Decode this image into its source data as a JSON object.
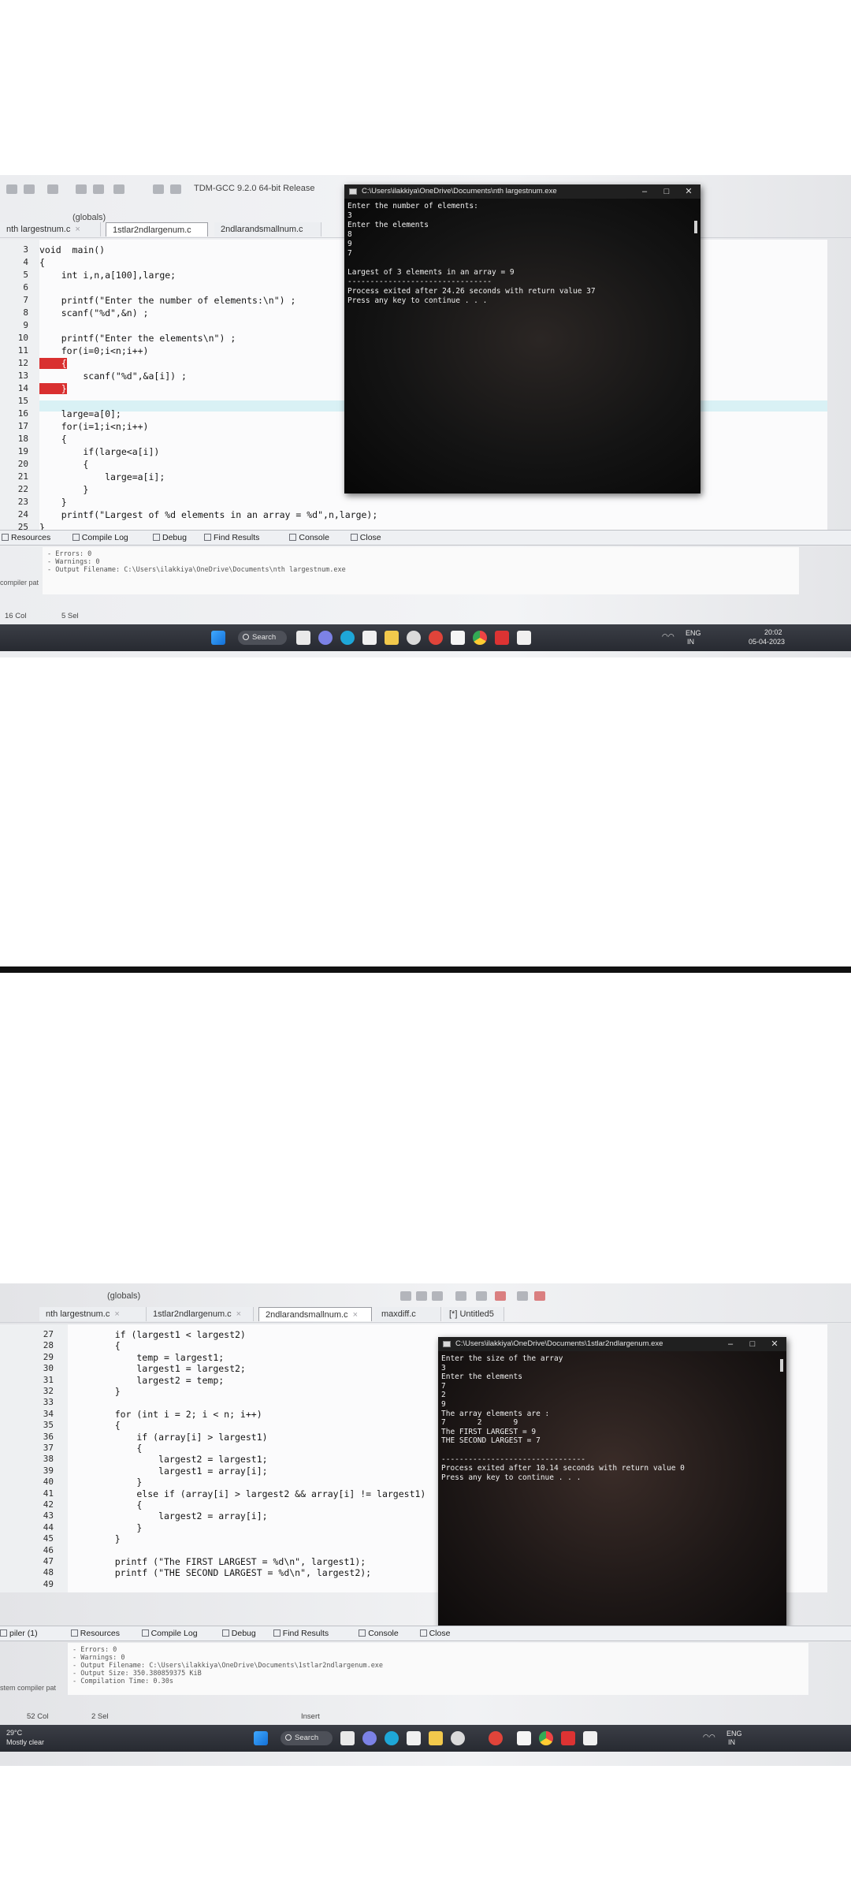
{
  "screen1": {
    "toolbar": {
      "compiler": "TDM-GCC 9.2.0 64-bit Release",
      "scope": "(globals)"
    },
    "tabs": [
      {
        "label": "nth largestnum.c"
      },
      {
        "label": "1stlar2ndlargenum.c"
      },
      {
        "label": "2ndlarandsmallnum.c"
      }
    ],
    "code_lines": [
      {
        "n": "3",
        "text": "void  main()"
      },
      {
        "n": "4",
        "text": "{"
      },
      {
        "n": "5",
        "text": "    int i,n,a[100],large;"
      },
      {
        "n": "6",
        "text": ""
      },
      {
        "n": "7",
        "text": "    printf(\"Enter the number of elements:\\n\") ;"
      },
      {
        "n": "8",
        "text": "    scanf(\"%d\",&n) ;"
      },
      {
        "n": "9",
        "text": ""
      },
      {
        "n": "10",
        "text": "    printf(\"Enter the elements\\n\") ;"
      },
      {
        "n": "11",
        "text": "    for(i=0;i<n;i++)"
      },
      {
        "n": "12",
        "text": "    {"
      },
      {
        "n": "13",
        "text": "        scanf(\"%d\",&a[i]) ;"
      },
      {
        "n": "14",
        "text": "    }"
      },
      {
        "n": "15",
        "text": ""
      },
      {
        "n": "16",
        "text": "    large=a[0];"
      },
      {
        "n": "17",
        "text": "    for(i=1;i<n;i++)"
      },
      {
        "n": "18",
        "text": "    {"
      },
      {
        "n": "19",
        "text": "        if(large<a[i])"
      },
      {
        "n": "20",
        "text": "        {"
      },
      {
        "n": "21",
        "text": "            large=a[i];"
      },
      {
        "n": "22",
        "text": "        }"
      },
      {
        "n": "23",
        "text": "    }"
      },
      {
        "n": "24",
        "text": "    printf(\"Largest of %d elements in an array = %d\",n,large);"
      },
      {
        "n": "25",
        "text": "}"
      }
    ],
    "console": {
      "title": "C:\\Users\\ilakkiya\\OneDrive\\Documents\\nth largestnum.exe",
      "lines": [
        "Enter the number of elements:",
        "3",
        "Enter the elements",
        "8",
        "9",
        "7",
        "",
        "Largest of 3 elements in an array = 9",
        "--------------------------------",
        "Process exited after 24.26 seconds with return value 37",
        "Press any key to continue . . ."
      ]
    },
    "bottom_tabs": [
      "Resources",
      "Compile Log",
      "Debug",
      "Find Results",
      "Console",
      "Close"
    ],
    "log_lines": [
      "- Errors: 0",
      "- Warnings: 0",
      "- Output Filename: C:\\Users\\ilakkiya\\OneDrive\\Documents\\nth largestnum.exe"
    ],
    "left_label": "compiler pat",
    "status": {
      "col": "16 Col",
      "sel": "5 Sel"
    },
    "taskbar": {
      "search": "Search",
      "lang": "ENG",
      "region": "IN",
      "time": "20:02",
      "date": "05-04-2023"
    }
  },
  "screen2": {
    "toolbar": {
      "scope": "(globals)"
    },
    "tabs": [
      {
        "label": "nth largestnum.c"
      },
      {
        "label": "1stlar2ndlargenum.c"
      },
      {
        "label": "2ndlarandsmallnum.c"
      },
      {
        "label": "maxdiff.c"
      },
      {
        "label": "[*] Untitled5"
      }
    ],
    "code_lines": [
      {
        "n": "27",
        "text": "    if (largest1 < largest2)"
      },
      {
        "n": "28",
        "text": "    {"
      },
      {
        "n": "29",
        "text": "        temp = largest1;"
      },
      {
        "n": "30",
        "text": "        largest1 = largest2;"
      },
      {
        "n": "31",
        "text": "        largest2 = temp;"
      },
      {
        "n": "32",
        "text": "    }"
      },
      {
        "n": "33",
        "text": ""
      },
      {
        "n": "34",
        "text": "    for (int i = 2; i < n; i++)"
      },
      {
        "n": "35",
        "text": "    {"
      },
      {
        "n": "36",
        "text": "        if (array[i] > largest1)"
      },
      {
        "n": "37",
        "text": "        {"
      },
      {
        "n": "38",
        "text": "            largest2 = largest1;"
      },
      {
        "n": "39",
        "text": "            largest1 = array[i];"
      },
      {
        "n": "40",
        "text": "        }"
      },
      {
        "n": "41",
        "text": "        else if (array[i] > largest2 && array[i] != largest1)"
      },
      {
        "n": "42",
        "text": "        {"
      },
      {
        "n": "43",
        "text": "            largest2 = array[i];"
      },
      {
        "n": "44",
        "text": "        }"
      },
      {
        "n": "45",
        "text": "    }"
      },
      {
        "n": "46",
        "text": ""
      },
      {
        "n": "47",
        "text": "    printf (\"The FIRST LARGEST = %d\\n\", largest1);"
      },
      {
        "n": "48",
        "text": "    printf (\"THE SECOND LARGEST = %d\\n\", largest2);"
      },
      {
        "n": "49",
        "text": ""
      }
    ],
    "console": {
      "title": "C:\\Users\\ilakkiya\\OneDrive\\Documents\\1stlar2ndlargenum.exe",
      "lines": [
        "Enter the size of the array",
        "3",
        "Enter the elements",
        "7",
        "2",
        "9",
        "The array elements are :",
        "7       2       9",
        "The FIRST LARGEST = 9",
        "THE SECOND LARGEST = 7",
        "",
        "--------------------------------",
        "Process exited after 10.14 seconds with return value 0",
        "Press any key to continue . . ."
      ]
    },
    "bottom_tabs": [
      "piler (1)",
      "Resources",
      "Compile Log",
      "Debug",
      "Find Results",
      "Console",
      "Close"
    ],
    "log_lines": [
      "- Errors: 0",
      "- Warnings: 0",
      "- Output Filename: C:\\Users\\ilakkiya\\OneDrive\\Documents\\1stlar2ndlargenum.exe",
      "- Output Size: 350.380859375 KiB",
      "- Compilation Time: 0.30s"
    ],
    "left_label": "stem compiler pat",
    "status": {
      "col": "52 Col",
      "sel": "2 Sel",
      "insert": "Insert"
    },
    "taskbar": {
      "weather_temp": "29°C",
      "weather_desc": "Mostly clear",
      "search": "Search",
      "lang": "ENG",
      "region": "IN"
    }
  }
}
